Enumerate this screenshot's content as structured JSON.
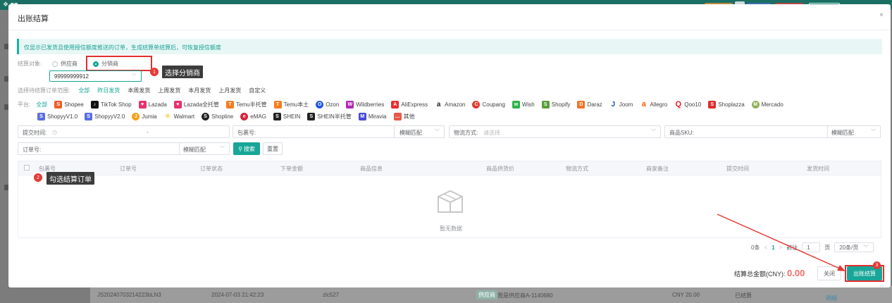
{
  "dialog": {
    "title": "出账结算",
    "close": "×",
    "notice": "仅显示已发货且使用授信额度推送的订单，生成结算单结算后，可恢复授信额度"
  },
  "settle_target": {
    "label": "结算对象:",
    "options": [
      "供应商",
      "分销商"
    ],
    "selected": "分销商",
    "account_value": "99999999912"
  },
  "annotations": {
    "step1": {
      "num": "1",
      "text": "选择分销商"
    },
    "step2": {
      "num": "2",
      "text": "勾选结算订单"
    },
    "step3": {
      "num": "3"
    }
  },
  "range": {
    "label": "选择待结算订单范围:",
    "items": [
      "全部",
      "昨日发货",
      "本周发货",
      "上周发货",
      "本月发货",
      "上月发货",
      "自定义"
    ]
  },
  "platform": {
    "label": "平台:",
    "items": [
      "全部",
      "Shopee",
      "TikTok Shop",
      "Lazada",
      "Lazada全托管",
      "Temu半托管",
      "Temu本土",
      "Ozon",
      "Wildberries",
      "AliExpress",
      "Amazon",
      "Coupang",
      "Wish",
      "Shopify",
      "Daraz",
      "Joom",
      "Allegro",
      "Qoo10",
      "Shoplazza",
      "Mercado",
      "ShopyyV1.0",
      "ShopyyV2.0",
      "Jumia",
      "Walmart",
      "Shopline",
      "eMAG",
      "SHEIN",
      "SHEIN半托管",
      "Miravia",
      "其他"
    ],
    "icons": {
      "shopee": "#f05d2a",
      "tiktok": "#111111",
      "lazada": "#e6316e",
      "temu": "#f57c1f",
      "ozon": "#1f58e6",
      "wb": "#b22ab8",
      "ali": "#e62e2e",
      "amazon": "#222222",
      "coupang": "#e23a2f",
      "wish": "#2fb24a",
      "shopify": "#5a9e3a",
      "daraz": "#f57224",
      "joom": "#1b4fa8",
      "allegro": "#ff5a00",
      "qoo10": "#e3202a",
      "shoplazza": "#e02b2b",
      "mercado": "#8fb054",
      "shopyy": "#5b6ee1",
      "jumia": "#f6a11a",
      "walmart": "#f2c217",
      "shopline": "#222222",
      "emag": "#d6243b",
      "shein": "#222222",
      "miravia": "#4a4ad8",
      "other": "#e8584a"
    }
  },
  "filters": {
    "submit_time_label": "提交时间:",
    "submit_time_sep": "-",
    "package_label": "包裹号:",
    "match_mode": "模糊匹配",
    "logistics_label": "物流方式:",
    "logistics_placeholder": "请选择",
    "sku_label": "商品SKU:",
    "order_label": "订单号:",
    "search_btn": "搜索",
    "reset_btn": "重置"
  },
  "table": {
    "headers": [
      "包裹号",
      "订单号",
      "订单状态",
      "下单金额",
      "商品信息",
      "商品供货价",
      "物流方式",
      "商家备注",
      "提交时间",
      "发货时间"
    ],
    "empty_text": "暂无数据"
  },
  "pager": {
    "total": "0条",
    "prev": "<",
    "current": "1",
    "next": ">",
    "goto": "前往",
    "goto_value": "1",
    "page_unit": "页",
    "page_size": "20条/页"
  },
  "footer": {
    "total_label": "结算总金额(CNY):",
    "total_value": "0.00",
    "close_btn": "关闭",
    "settle_btn": "出账结算"
  },
  "background_row": {
    "package": "JS20240703214223bLN3",
    "time": "2024-07-03 21:42:23",
    "user": "zlc527",
    "tag": "供应商",
    "supplier": "我是供应商A-1140680",
    "amount": "CNY 20.00",
    "status": "已结算",
    "link": "明细"
  },
  "colors": {
    "primary": "#17a697",
    "annotation": "#e53935"
  }
}
